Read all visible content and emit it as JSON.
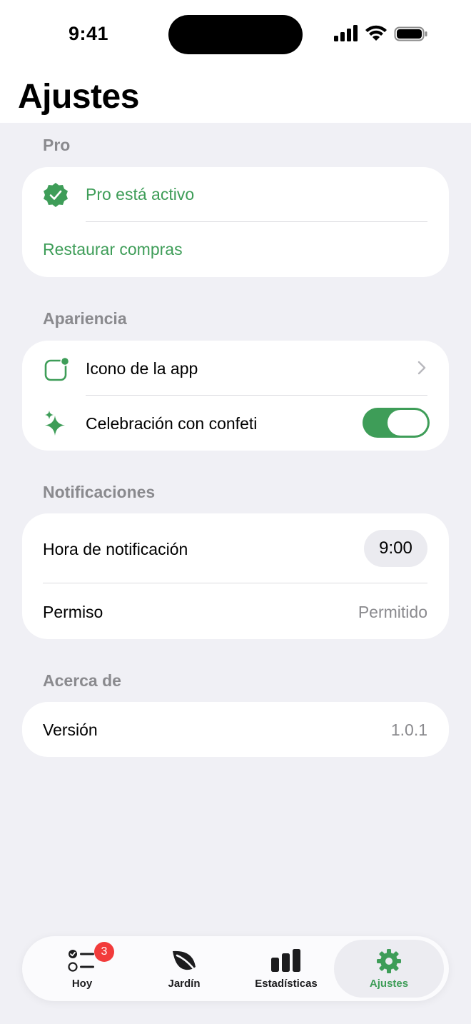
{
  "status_bar": {
    "time": "9:41"
  },
  "page": {
    "title": "Ajustes"
  },
  "sections": {
    "pro": {
      "header": "Pro",
      "pro_active": "Pro está activo",
      "restore": "Restaurar compras"
    },
    "appearance": {
      "header": "Apariencia",
      "app_icon": "Icono de la app",
      "confetti": "Celebración con confeti",
      "confetti_enabled": true
    },
    "notifications": {
      "header": "Notificaciones",
      "time_label": "Hora de notificación",
      "time_value": "9:00",
      "permission_label": "Permiso",
      "permission_value": "Permitido"
    },
    "about": {
      "header": "Acerca de",
      "version_label": "Versión",
      "version_value": "1.0.1"
    }
  },
  "tabbar": {
    "tabs": [
      {
        "label": "Hoy",
        "icon": "checklist-icon",
        "badge": "3"
      },
      {
        "label": "Jardín",
        "icon": "leaf-icon"
      },
      {
        "label": "Estadísticas",
        "icon": "bar-chart-icon"
      },
      {
        "label": "Ajustes",
        "icon": "gear-icon",
        "active": true
      }
    ]
  },
  "colors": {
    "accent": "#3e9d58",
    "badge": "#f23b3b",
    "background": "#f0f0f5"
  }
}
